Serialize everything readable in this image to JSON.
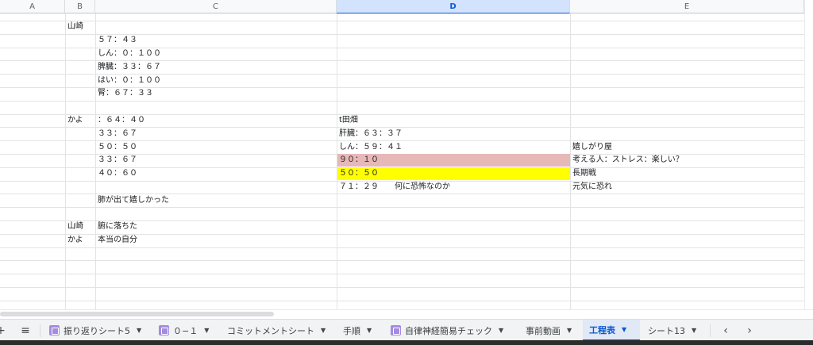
{
  "columns": [
    "A",
    "B",
    "C",
    "D",
    "E"
  ],
  "cells": {
    "r2b": "山崎",
    "r3c": "５７：４３",
    "r4c": "しん：０：１００",
    "r5c": "脾臓：３３：６７",
    "r6c": "はい：０：１００",
    "r7c": "腎：６７：３３",
    "r9b": "かよ",
    "r9c": "：６４：４０",
    "r9d": "t田畑",
    "r10c": "３３：６７",
    "r10d": "肝臓：６３：３７",
    "r11c": "５０：５０",
    "r11d": "しん：５９：４１",
    "r11e": "嬉しがり屋",
    "r12c": "３３：６７",
    "r12d": "９０：１０",
    "r12e": "考える人：ストレス：楽しい？",
    "r13c": "４０：６０",
    "r13d": "５０：５０",
    "r13e": "長期戦",
    "r14d": "７１：２９　　何に恐怖なのか",
    "r14e": "元気に恐れ",
    "r15c": "肺が出て嬉しかった",
    "r17b": "山崎",
    "r17c": "腑に落ちた",
    "r18b": "かよ",
    "r18c": "本当の自分"
  },
  "fills": {
    "r12d": "#e6b8b7",
    "r13d": "#ffff00"
  },
  "tabs": [
    {
      "label": "振り返りシート5",
      "icon": "sheet-icon",
      "active": false
    },
    {
      "label": "０−１",
      "icon": "sheet-icon",
      "active": false
    },
    {
      "label": "コミットメントシート",
      "icon": "",
      "active": false
    },
    {
      "label": "手順",
      "icon": "",
      "active": false
    },
    {
      "label": "自律神経簡易チェック",
      "icon": "sheet-icon",
      "active": false
    },
    {
      "label": "事前動画",
      "icon": "",
      "active": false
    },
    {
      "label": "工程表",
      "icon": "",
      "active": true
    },
    {
      "label": "シート13",
      "icon": "",
      "active": false
    }
  ],
  "tabbar": {
    "add_glyph": "+",
    "menu_glyph": "≡",
    "prev_glyph": "‹",
    "next_glyph": "›",
    "caret_glyph": "▼"
  },
  "colors": {
    "selected_column": "#d3e3fd",
    "accent": "#0b57d0"
  }
}
